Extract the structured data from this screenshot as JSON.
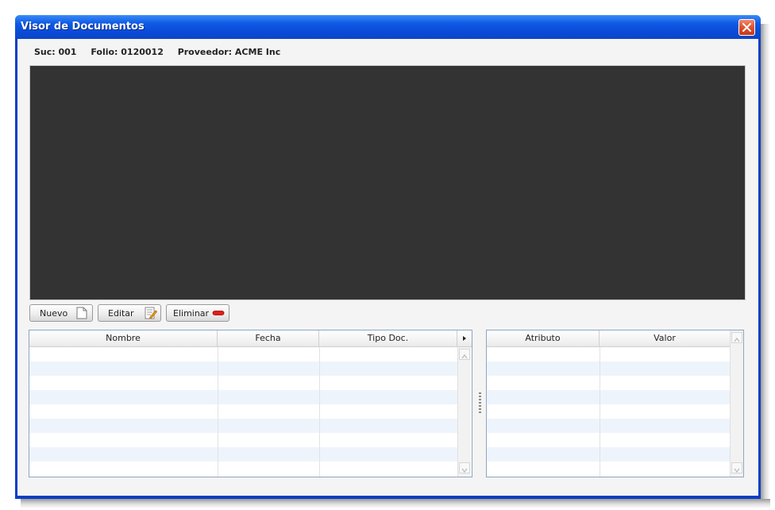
{
  "window": {
    "title": "Visor de Documentos",
    "close_icon": "close-icon"
  },
  "info": {
    "suc": "Suc: 001",
    "folio": "Folio: 0120012",
    "proveedor": "Proveedor: ACME Inc"
  },
  "toolbar": {
    "nuevo_label": "Nuevo",
    "nuevo_icon": "new-document-icon",
    "editar_label": "Editar",
    "editar_icon": "edit-document-icon",
    "eliminar_label": "Eliminar",
    "eliminar_icon": "remove-icon"
  },
  "documents_table": {
    "columns": [
      "Nombre",
      "Fecha",
      "Tipo Doc."
    ],
    "column_menu_icon": "column-menu-arrow-icon",
    "rows": []
  },
  "attributes_table": {
    "columns": [
      "Atributo",
      "Valor"
    ],
    "rows": []
  },
  "colors": {
    "title_bar": "#0a4bd6",
    "viewer_background": "#333333",
    "alt_row": "#eef4fb",
    "close_button": "#e0502c",
    "remove_icon": "#e41b1b"
  }
}
